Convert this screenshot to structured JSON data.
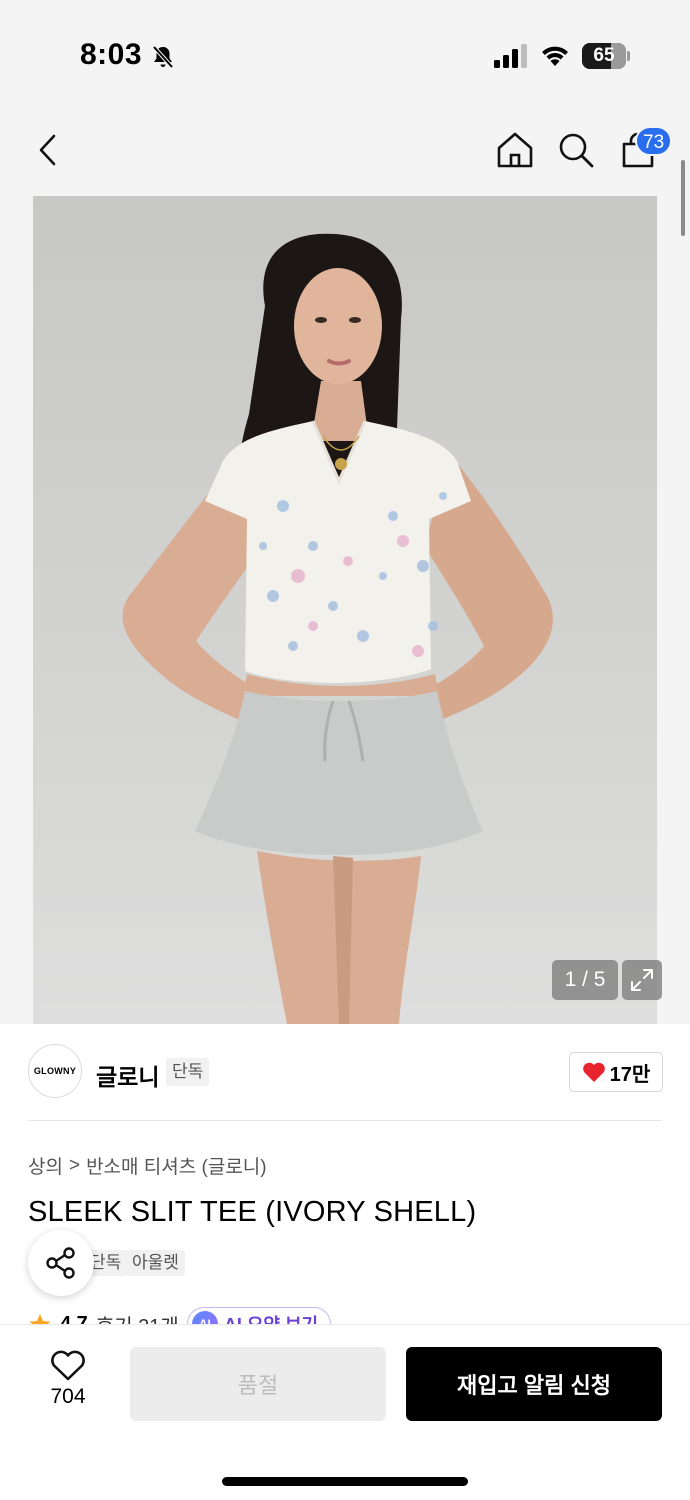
{
  "status_bar": {
    "time": "8:03",
    "battery": "65",
    "battery_level": 0.65
  },
  "nav": {
    "cart_count": "73"
  },
  "gallery": {
    "counter": "1 / 5"
  },
  "brand": {
    "logo_text": "GLOWNY",
    "name": "글로니",
    "badge": "단독",
    "likes": "17만"
  },
  "breadcrumb": {
    "category": "상의",
    "separator": ">",
    "subcategory": "반소매 티셔츠 (글로니)"
  },
  "product": {
    "title": "SLEEK SLIT TEE (IVORY SHELL)",
    "tags": [
      "단독",
      "아울렛"
    ]
  },
  "rating": {
    "value": "4.7",
    "reviews": "후기 21개",
    "ai_icon": "AI",
    "ai_label": "AI 요약 보기"
  },
  "bottom_bar": {
    "wish_count": "704",
    "soldout_label": "품절",
    "restock_label": "재입고 알림 신청"
  },
  "colors": {
    "accent_blue": "#2a6ef0",
    "heart_red": "#e8232e",
    "star_orange": "#f6a623",
    "ai_purple": "#6a3fd6"
  }
}
